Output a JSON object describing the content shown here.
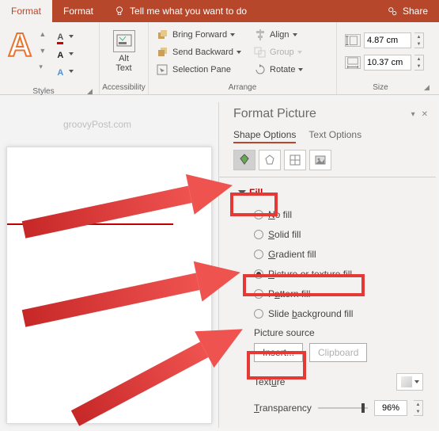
{
  "tabs": {
    "format1": "Format",
    "format2": "Format",
    "tell": "Tell me what you want to do",
    "share": "Share"
  },
  "ribbon": {
    "styles_label": "Styles",
    "acc_label": "Accessibility",
    "alt_text": "Alt\nText",
    "arrange_label": "Arrange",
    "bring_forward": "Bring Forward",
    "send_backward": "Send Backward",
    "selection_pane": "Selection Pane",
    "align": "Align",
    "group": "Group",
    "rotate": "Rotate",
    "size_label": "Size",
    "height": "4.87 cm",
    "width": "10.37 cm"
  },
  "watermark": "groovyPost.com",
  "pane": {
    "title": "Format Picture",
    "shape_options": "Shape Options",
    "text_options": "Text Options",
    "fill": "Fill",
    "no_fill": "No fill",
    "solid_fill": "Solid fill",
    "gradient_fill": "Gradient fill",
    "picture_texture": "Picture or texture fill",
    "pattern_fill": "Pattern fill",
    "slide_bg": "Slide background fill",
    "picture_source": "Picture source",
    "insert": "Insert...",
    "clipboard": "Clipboard",
    "texture": "Texture",
    "transparency": "Transparency",
    "transparency_val": "96%"
  }
}
